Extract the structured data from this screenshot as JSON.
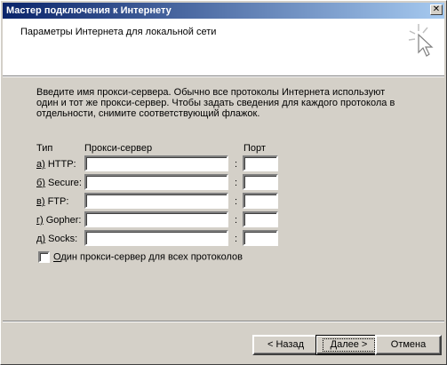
{
  "window": {
    "title": "Мастер подключения к Интернету",
    "close_glyph": "✕"
  },
  "header": {
    "subtitle": "Параметры Интернета для локальной сети"
  },
  "description": "Введите имя прокси-сервера. Обычно все протоколы Интернета используют один и тот же прокси-сервер. Чтобы задать сведения для каждого протокола в отдельности, снимите соответствующий флажок.",
  "columns": {
    "type": "Тип",
    "proxy": "Прокси-сервер",
    "port": "Порт"
  },
  "rows": [
    {
      "hotkey": "а)",
      "label": " HTTP:",
      "proxy": "",
      "port": ""
    },
    {
      "hotkey": "б)",
      "label": " Secure:",
      "proxy": "",
      "port": ""
    },
    {
      "hotkey": "в)",
      "label": " FTP:",
      "proxy": "",
      "port": ""
    },
    {
      "hotkey": "г)",
      "label": " Gopher:",
      "proxy": "",
      "port": ""
    },
    {
      "hotkey": "д)",
      "label": " Socks:",
      "proxy": "",
      "port": ""
    }
  ],
  "colon": ":",
  "same_proxy": {
    "hotkey": "О",
    "label": "дин прокси-сервер для всех протоколов",
    "checked": false
  },
  "buttons": {
    "back": "< Назад",
    "next": "Далее >",
    "cancel": "Отмена"
  }
}
